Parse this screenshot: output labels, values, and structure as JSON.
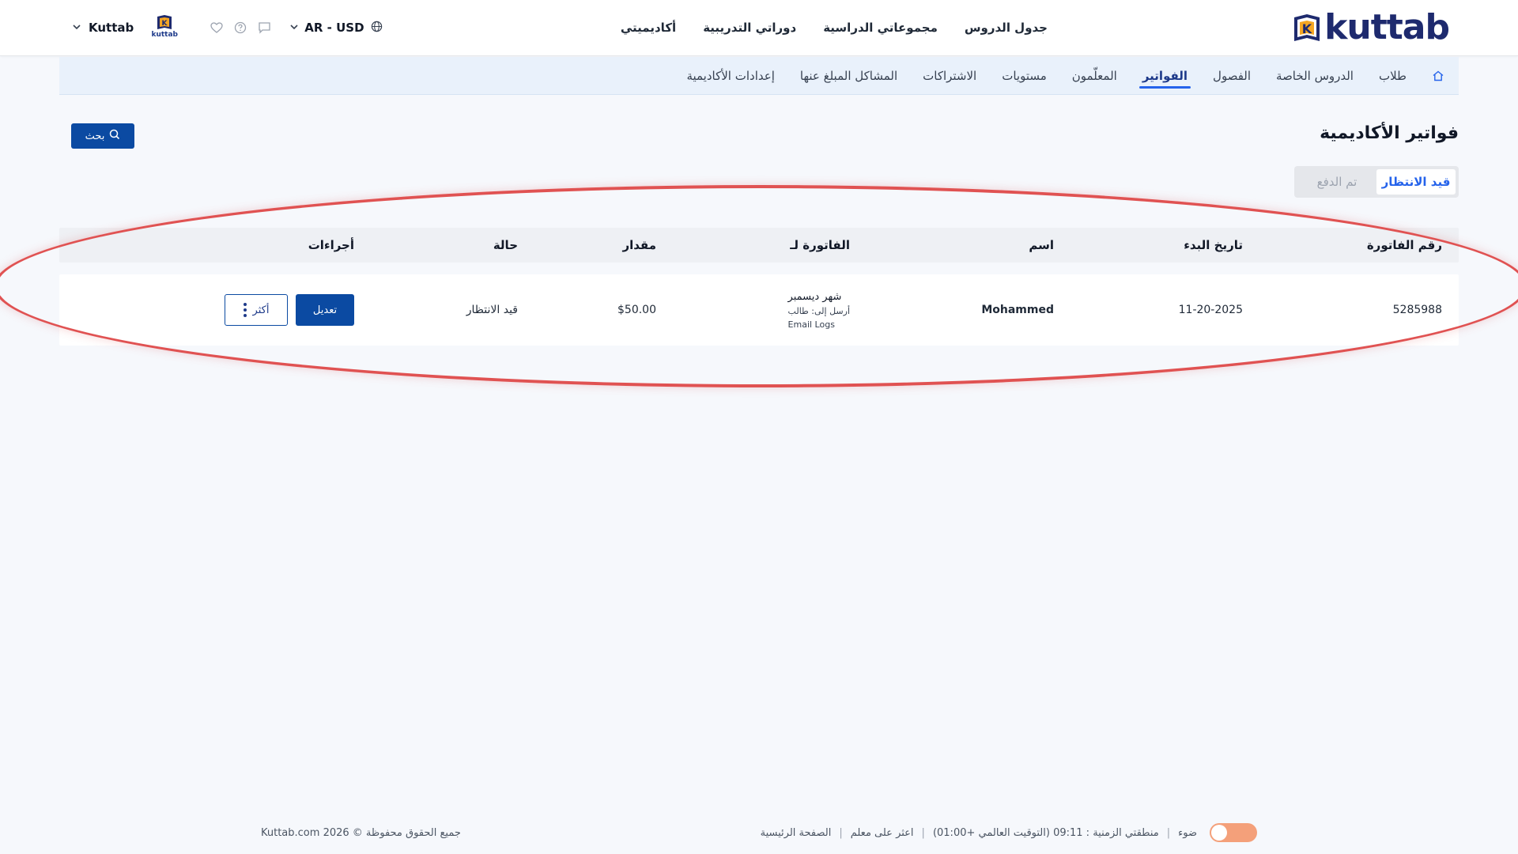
{
  "brand": {
    "logo_text": "kuttab",
    "logo_mark_letter": "K"
  },
  "top_nav": [
    "جدول الدروس",
    "مجموعاتي الدراسية",
    "دوراتي التدريبية",
    "أكاديميتي"
  ],
  "top_bar": {
    "currency_label": "AR - USD",
    "user_name": "Kuttab",
    "avatar_label": "kuttab"
  },
  "sub_nav": {
    "items": [
      "طلاب",
      "الدروس الخاصة",
      "الفصول",
      "الفواتير",
      "المعلّمون",
      "مستويات",
      "الاشتراكات",
      "المشاكل المبلغ عنها",
      "إعدادات الأكاديمية"
    ],
    "active": "الفواتير"
  },
  "page": {
    "title": "فواتير الأكاديمية",
    "search_label": "بحث"
  },
  "tabs": [
    {
      "label": "قيد الانتظار",
      "active": true
    },
    {
      "label": "تم الدفع",
      "active": false
    }
  ],
  "table": {
    "headers": {
      "invoice_no": "رقم الفاتورة",
      "start_date": "تاريخ البدء",
      "name": "اسم",
      "invoice_for": "الفاتورة لـ",
      "amount": "مقدار",
      "status": "حالة",
      "actions": "أجراءات"
    },
    "rows": [
      {
        "invoice_no": "5285988",
        "start_date": "11-20-2025",
        "name": "Mohammed",
        "invoice_for_title": "شهر ديسمبر",
        "invoice_for_sent": "أرسل إلى: طالب",
        "invoice_for_logs": "Email Logs",
        "amount": "$50.00",
        "status": "قيد الانتظار",
        "edit_label": "تعديل",
        "more_label": "أكثر"
      }
    ]
  },
  "footer": {
    "home": "الصفحة الرئيسية",
    "find_teacher": "اعثر على معلم",
    "timezone": "منطقتي الزمنية : 09:11 (التوقيت العالمي +01:00)",
    "theme_label": "ضوء",
    "copyright": "جميع الحقوق محفوظة © 2026 Kuttab.com"
  },
  "colors": {
    "primary": "#0b4aa2",
    "accent": "#2563eb",
    "highlight": "#e05252",
    "toggle": "#f4a07a"
  }
}
